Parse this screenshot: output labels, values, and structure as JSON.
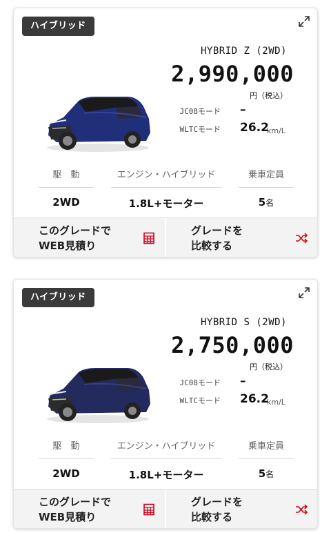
{
  "grades": [
    {
      "badge": "ハイブリッド",
      "name": "HYBRID Z (2WD)",
      "price": "2,990,000",
      "price_unit": "円（税込）",
      "car_color": "#1f2f7a",
      "fuel": [
        {
          "label": "JC08モード",
          "value": "–",
          "unit": ""
        },
        {
          "label": "WLTCモード",
          "value": "26.2",
          "unit": "km/L"
        }
      ],
      "specs": [
        {
          "header": "駆　動",
          "value": "2WD",
          "suffix": ""
        },
        {
          "header": "エンジン・ハイブリッド",
          "value": "1.8L+モーター",
          "suffix": ""
        },
        {
          "header": "乗車定員",
          "value": "5",
          "suffix": "名"
        }
      ],
      "actions": [
        {
          "line1": "このグレードで",
          "line2": "WEB見積り",
          "icon": "calculator-icon"
        },
        {
          "line1": "グレードを",
          "line2": "比較する",
          "icon": "shuffle-icon"
        }
      ]
    },
    {
      "badge": "ハイブリッド",
      "name": "HYBRID S (2WD)",
      "price": "2,750,000",
      "price_unit": "円（税込）",
      "car_color": "#232a5e",
      "fuel": [
        {
          "label": "JC08モード",
          "value": "–",
          "unit": ""
        },
        {
          "label": "WLTCモード",
          "value": "26.2",
          "unit": "km/L"
        }
      ],
      "specs": [
        {
          "header": "駆　動",
          "value": "2WD",
          "suffix": ""
        },
        {
          "header": "エンジン・ハイブリッド",
          "value": "1.8L+モーター",
          "suffix": ""
        },
        {
          "header": "乗車定員",
          "value": "5",
          "suffix": "名"
        }
      ],
      "actions": [
        {
          "line1": "このグレードで",
          "line2": "WEB見積り",
          "icon": "calculator-icon"
        },
        {
          "line1": "グレードを",
          "line2": "比較する",
          "icon": "shuffle-icon"
        }
      ]
    }
  ],
  "colors": {
    "accent": "#d0021b",
    "badge_bg": "#3a3a3a"
  }
}
